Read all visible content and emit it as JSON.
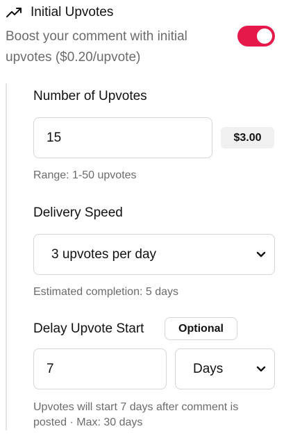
{
  "header": {
    "title": "Initial Upvotes",
    "icon": "trending-up-icon"
  },
  "description": "Boost your comment with initial upvotes ($0.20/upvote)",
  "toggle": {
    "state": "on",
    "color": "#e6194b"
  },
  "upvotes": {
    "label": "Number of Upvotes",
    "value": "15",
    "price": "$3.00",
    "hint": "Range: 1-50 upvotes"
  },
  "delivery": {
    "label": "Delivery Speed",
    "selected": "3 upvotes per day",
    "hint": "Estimated completion: 5 days"
  },
  "delay": {
    "label": "Delay Upvote Start",
    "optional_badge": "Optional",
    "value": "7",
    "unit_selected": "Days",
    "hint": "Upvotes will start 7 days after comment is posted · Max: 30 days"
  }
}
